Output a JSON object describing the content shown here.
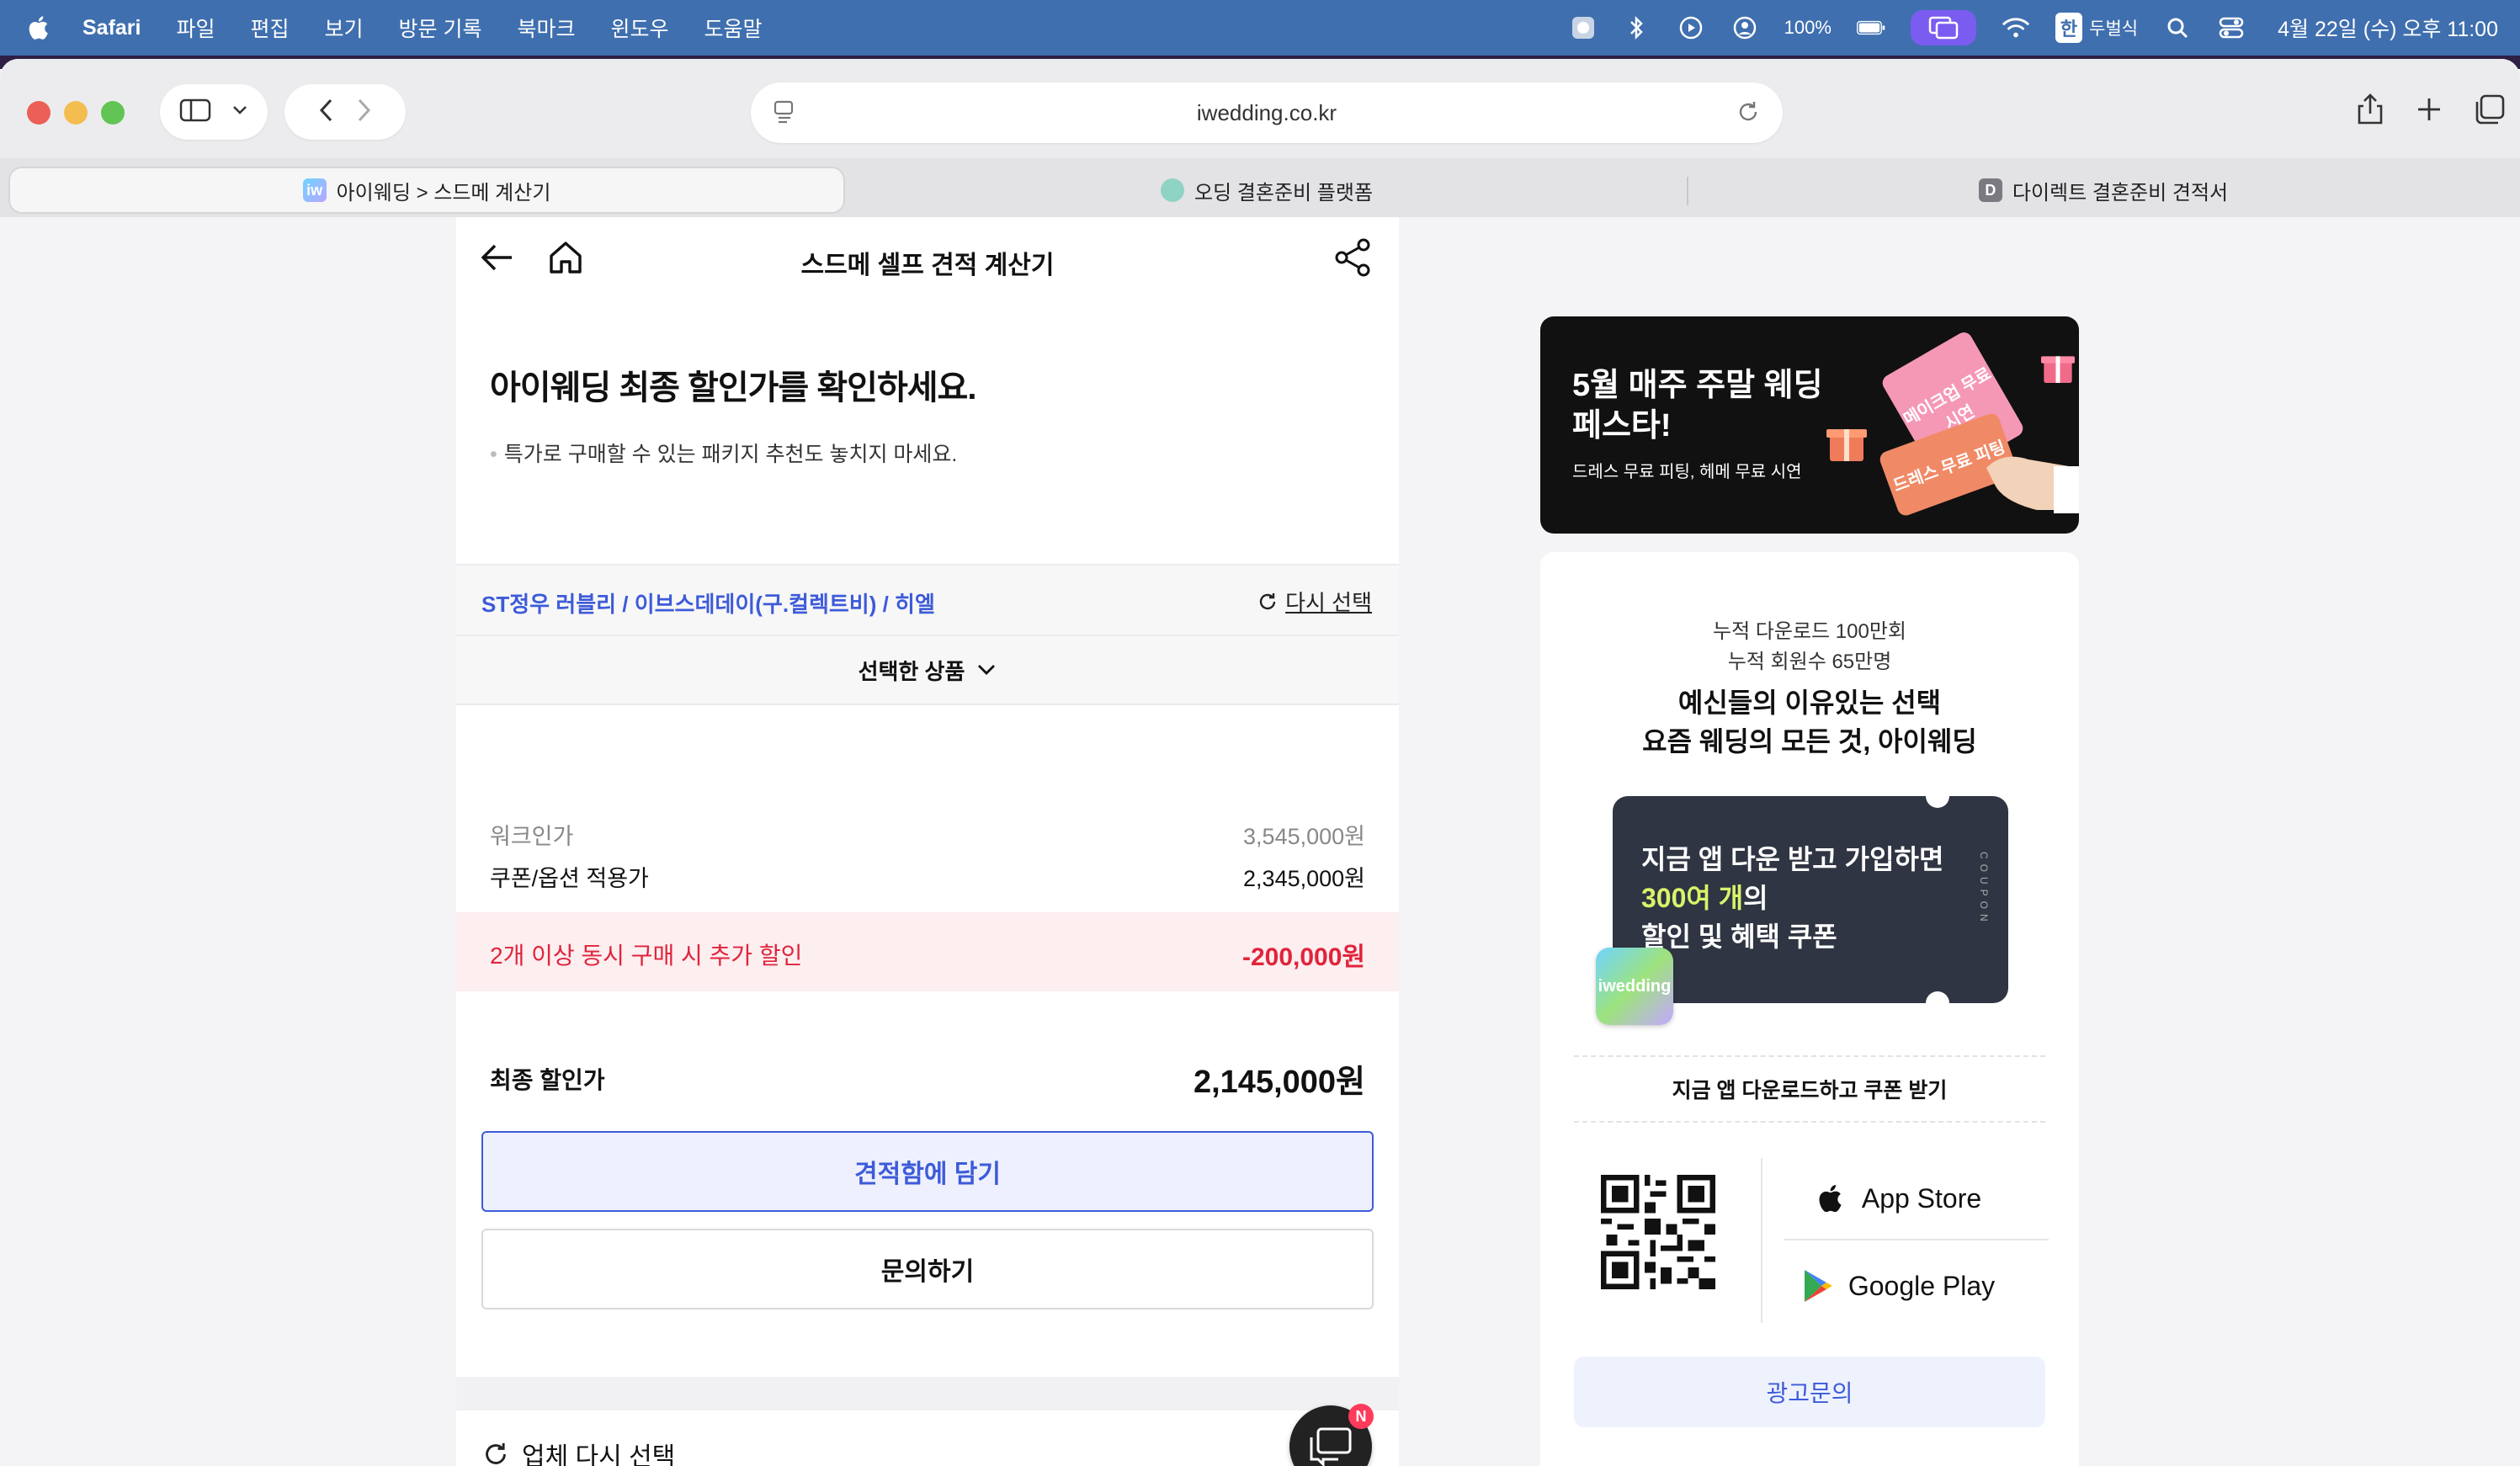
{
  "menubar": {
    "app": "Safari",
    "items": [
      "파일",
      "편집",
      "보기",
      "방문 기록",
      "북마크",
      "윈도우",
      "도움말"
    ],
    "battery": "100%",
    "input_badge": "한",
    "input_method": "두벌식",
    "datetime": "4월 22일 (수) 오후 11:00"
  },
  "browser": {
    "url": "iwedding.co.kr",
    "tabs": [
      {
        "label": "아이웨딩 > 스드메 계산기",
        "active": true
      },
      {
        "label": "오딩 결혼준비 플랫폼",
        "active": false
      },
      {
        "label": "다이렉트 결혼준비 견적서",
        "active": false,
        "favicon_letter": "D"
      }
    ]
  },
  "calculator": {
    "title": "스드메 셀프 견적 계산기",
    "heading": "아이웨딩 최종 할인가를 확인하세요.",
    "subnote": "특가로 구매할 수 있는 패키지 추천도 놓치지 마세요.",
    "selected_names": "ST정우 러블리 / 이브스데데이(구.컬렉트비) / 히엘",
    "reselect": "다시 선택",
    "selected_toggle": "선택한 상품",
    "walkin_label": "워크인가",
    "walkin_price": "3,545,000원",
    "coupon_label": "쿠폰/옵션 적용가",
    "coupon_price": "2,345,000원",
    "multi_discount_label": "2개 이상 동시 구매 시 추가 할인",
    "multi_discount_value": "-200,000원",
    "final_label": "최종 할인가",
    "final_price": "2,145,000원",
    "cart_button": "견적함에 담기",
    "inquire_button": "문의하기",
    "vendor_reselect": "업체 다시 선택",
    "chat_badge": "N"
  },
  "banner": {
    "title": "5월 매주 주말 웨딩 페스타!",
    "subtitle": "드레스 무료 피팅, 헤메 무료 시연",
    "ticket1": "메이크업 무료 시연",
    "ticket2": "드레스 무료 피팅"
  },
  "promo": {
    "downloads": "누적 다운로드 100만회",
    "members": "누적 회원수 65만명",
    "tagline1": "예신들의 이유있는 선택",
    "tagline2": "요즘 웨딩의 모든 것, 아이웨딩",
    "coupon_line1": "지금 앱 다운 받고 가입하면",
    "coupon_highlight": "300여 개",
    "coupon_line2_suffix": "의",
    "coupon_line3": "할인 및 혜택 쿠폰",
    "coupon_side": "COUPON",
    "logo_text": "iwedding",
    "download_cta": "지금 앱 다운로드하고 쿠폰 받기",
    "app_store": "App Store",
    "google_play": "Google Play",
    "ad_button": "광고문의"
  },
  "colors": {
    "accent": "#3d5bd9",
    "discount": "#e0243b",
    "menubar": "#3f6fae",
    "coupon_highlight": "#d9f36b"
  }
}
